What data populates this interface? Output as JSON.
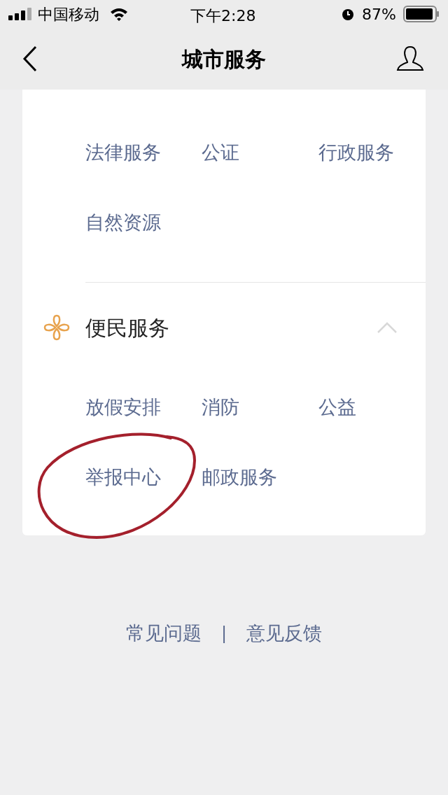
{
  "status_bar": {
    "carrier": "中国移动",
    "time": "下午2:28",
    "battery": "87%"
  },
  "nav": {
    "title": "城市服务"
  },
  "groups": [
    {
      "items": [
        "法律服务",
        "公证",
        "行政服务",
        "自然资源"
      ]
    },
    {
      "title": "便民服务",
      "expanded": true,
      "items": [
        "放假安排",
        "消防",
        "公益",
        "举报中心",
        "邮政服务"
      ]
    }
  ],
  "footer": {
    "links": [
      "常见问题",
      "意见反馈"
    ],
    "separator": "|"
  }
}
